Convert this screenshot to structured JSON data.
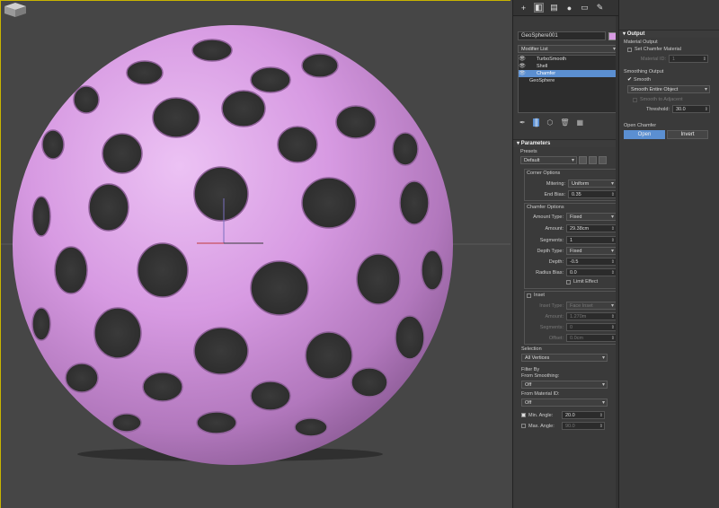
{
  "viewport": {
    "label": "3D viewport perspective"
  },
  "command_panel": {
    "object_name": "GeoSphere001",
    "object_color": "#d79ae2",
    "modifier_list_label": "Modifier List",
    "stack": [
      {
        "label": "TurboSmooth",
        "selected": false
      },
      {
        "label": "Shell",
        "selected": false
      },
      {
        "label": "Chamfer",
        "selected": true
      },
      {
        "label": "GeoSphere",
        "selected": false
      }
    ],
    "parameters": {
      "header": "Parameters",
      "presets_label": "Presets",
      "presets_value": "Default",
      "corner_options_label": "Corner Options",
      "mitering_label": "Mitering:",
      "mitering_value": "Uniform",
      "end_bias_label": "End Bias:",
      "end_bias_value": "0.35",
      "chamfer_options_label": "Chamfer Options",
      "amount_type_label": "Amount Type:",
      "amount_type_value": "Fixed",
      "amount_label": "Amount:",
      "amount_value": "29.38cm",
      "segments_label": "Segments:",
      "segments_value": "1",
      "depth_type_label": "Depth Type:",
      "depth_type_value": "Fixed",
      "depth_label": "Depth:",
      "depth_value": "-0.5",
      "radius_bias_label": "Radius Bias:",
      "radius_bias_value": "0.0",
      "limit_effect_label": "Limit Effect",
      "inset_label": "Inset",
      "inset_type_label": "Inset Type:",
      "inset_type_value": "Face Inset",
      "inset_amount_label": "Amount:",
      "inset_amount_value": "1.270m",
      "inset_segments_label": "Segments:",
      "inset_segments_value": "0",
      "inset_offset_label": "Offset:",
      "inset_offset_value": "0.0cm",
      "selection_label": "Selection",
      "selection_value": "All Vertices",
      "filter_by_label": "Filter By",
      "from_smoothing_label": "From Smoothing:",
      "from_smoothing_value": "Off",
      "from_material_label": "From Material ID:",
      "from_material_value": "Off",
      "min_angle_label": "Min. Angle:",
      "min_angle_value": "20.0",
      "max_angle_label": "Max. Angle:",
      "max_angle_value": "90.0"
    }
  },
  "output_panel": {
    "header": "Output",
    "material_output_label": "Material Output",
    "set_chamfer_material_label": "Set Chamfer Material",
    "material_id_label": "Material ID:",
    "material_id_value": "1",
    "smoothing_output_label": "Smoothing Output",
    "smooth_label": "Smooth",
    "smooth_mode_value": "Smooth Entire Object",
    "smooth_adjacent_label": "Smooth to Adjacent",
    "threshold_label": "Threshold:",
    "threshold_value": "30.0",
    "open_chamfer_label": "Open Chamfer",
    "open_button": "Open",
    "invert_button": "Invert"
  }
}
